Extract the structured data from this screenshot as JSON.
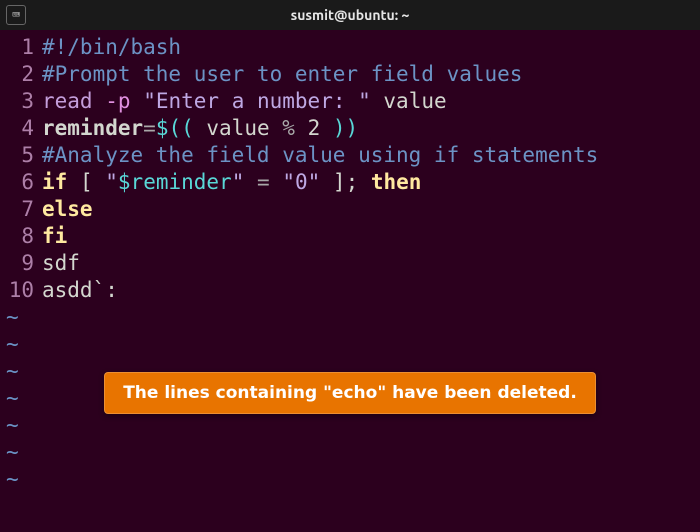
{
  "titlebar": {
    "icon_label": "⌨",
    "title": "susmit@ubuntu: ~"
  },
  "lines": [
    {
      "n": "1",
      "segments": [
        {
          "cls": "c-comment",
          "t": "#!/bin/bash"
        }
      ]
    },
    {
      "n": "2",
      "segments": [
        {
          "cls": "c-comment",
          "t": "#Prompt the user to enter field values"
        }
      ]
    },
    {
      "n": "3",
      "segments": [
        {
          "cls": "c-builtin",
          "t": "read"
        },
        {
          "cls": "c-plain",
          "t": " "
        },
        {
          "cls": "c-flag",
          "t": "-p"
        },
        {
          "cls": "c-plain",
          "t": " "
        },
        {
          "cls": "c-str",
          "t": "\"Enter a number: \""
        },
        {
          "cls": "c-plain",
          "t": " value"
        }
      ]
    },
    {
      "n": "4",
      "segments": [
        {
          "cls": "c-var",
          "t": "reminder"
        },
        {
          "cls": "c-op",
          "t": "="
        },
        {
          "cls": "c-varref",
          "t": "$(("
        },
        {
          "cls": "c-plain",
          "t": " value "
        },
        {
          "cls": "c-op",
          "t": "%"
        },
        {
          "cls": "c-plain",
          "t": " 2 "
        },
        {
          "cls": "c-varref",
          "t": "))"
        }
      ]
    },
    {
      "n": "5",
      "segments": [
        {
          "cls": "c-comment",
          "t": "#Analyze the field value using if statements"
        }
      ]
    },
    {
      "n": "6",
      "segments": [
        {
          "cls": "c-kw",
          "t": "if"
        },
        {
          "cls": "c-plain",
          "t": " "
        },
        {
          "cls": "c-punct",
          "t": "[ "
        },
        {
          "cls": "c-str",
          "t": "\""
        },
        {
          "cls": "c-varref",
          "t": "$reminder"
        },
        {
          "cls": "c-str",
          "t": "\""
        },
        {
          "cls": "c-plain",
          "t": " "
        },
        {
          "cls": "c-op",
          "t": "="
        },
        {
          "cls": "c-plain",
          "t": " "
        },
        {
          "cls": "c-str",
          "t": "\"0\""
        },
        {
          "cls": "c-plain",
          "t": " "
        },
        {
          "cls": "c-punct",
          "t": "]; "
        },
        {
          "cls": "c-kw",
          "t": "then"
        }
      ]
    },
    {
      "n": "7",
      "segments": [
        {
          "cls": "c-kw",
          "t": "else"
        }
      ]
    },
    {
      "n": "8",
      "segments": [
        {
          "cls": "c-kw",
          "t": "fi"
        }
      ]
    },
    {
      "n": "9",
      "segments": [
        {
          "cls": "c-plain",
          "t": "sdf"
        }
      ]
    },
    {
      "n": "10",
      "segments": [
        {
          "cls": "c-plain",
          "t": "asdd`:"
        }
      ]
    }
  ],
  "tilde_count": 7,
  "tilde_char": "~",
  "overlay": {
    "text": "The lines containing \"echo\" have been deleted."
  }
}
